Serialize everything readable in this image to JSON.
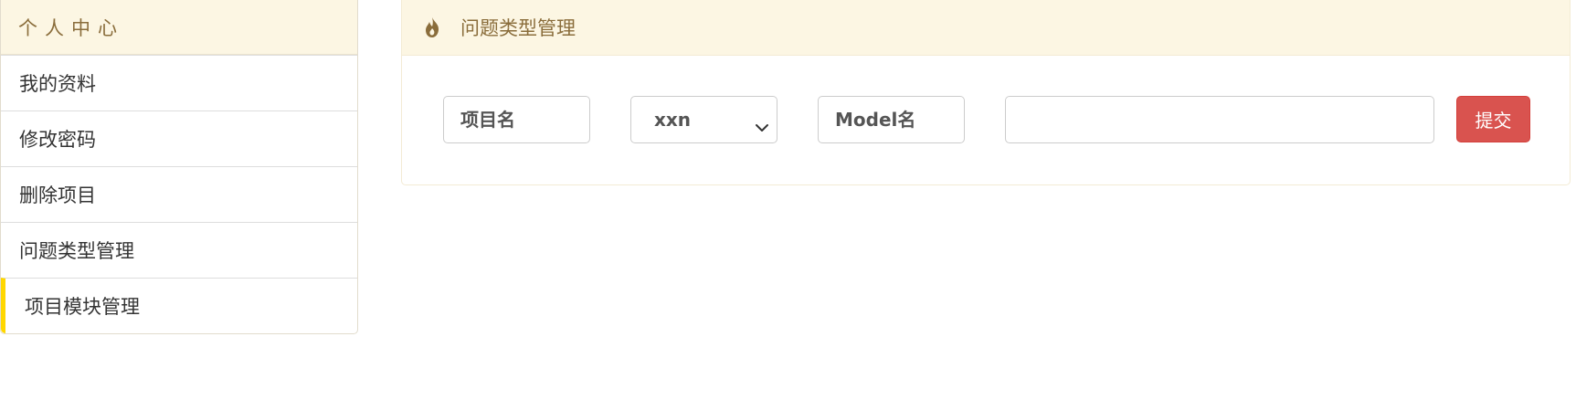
{
  "sidebar": {
    "header": "个人中心",
    "items": [
      {
        "label": "我的资料",
        "active": false
      },
      {
        "label": "修改密码",
        "active": false
      },
      {
        "label": "删除项目",
        "active": false
      },
      {
        "label": "问题类型管理",
        "active": false
      },
      {
        "label": "项目模块管理",
        "active": true
      }
    ],
    "active_indicator_color": "#ffd700"
  },
  "panel": {
    "icon": "fire-icon",
    "title": "问题类型管理",
    "heading_background": "#fcf6e3",
    "heading_text_color": "#8a6d3b"
  },
  "form": {
    "project_name_placeholder": "项目名",
    "project_select_value": "xxn",
    "model_name_placeholder": "Model名",
    "text_value": "",
    "submit_label": "提交",
    "submit_color": "#d9534f"
  }
}
